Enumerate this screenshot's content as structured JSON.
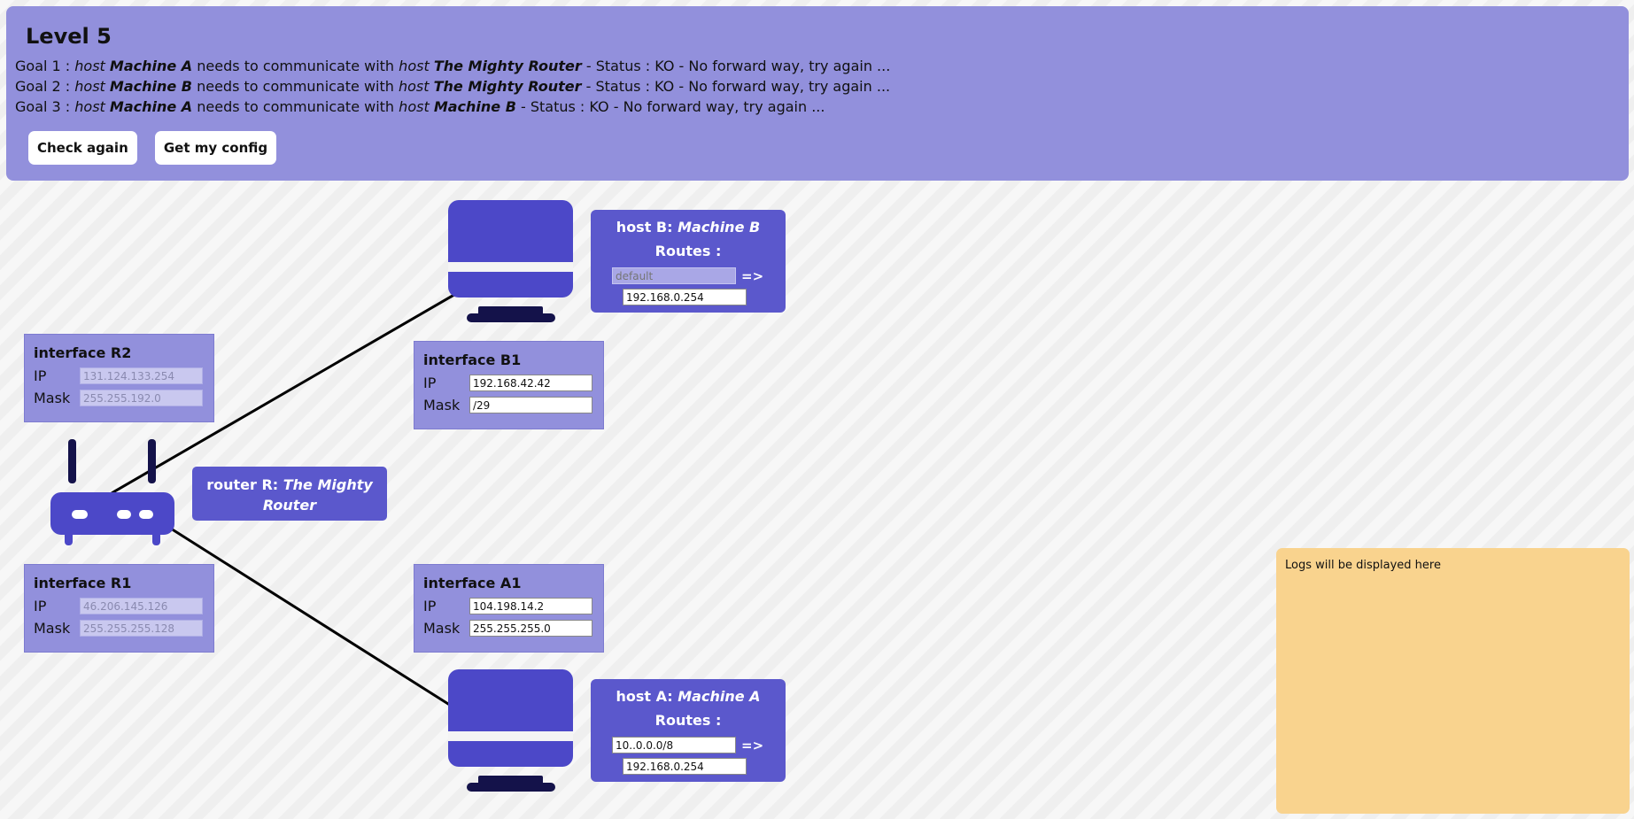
{
  "header": {
    "title": "Level 5",
    "goals": [
      {
        "prefix": "Goal 1 : ",
        "h1_type": "host",
        "h1_name": "Machine A",
        "mid": "needs to communicate with",
        "h2_type": "host",
        "h2_name": "The Mighty Router",
        "status": "- Status : KO - No forward way, try again ..."
      },
      {
        "prefix": "Goal 2 : ",
        "h1_type": "host",
        "h1_name": "Machine B",
        "mid": "needs to communicate with",
        "h2_type": "host",
        "h2_name": "The Mighty Router",
        "status": "- Status : KO - No forward way, try again ..."
      },
      {
        "prefix": "Goal 3 : ",
        "h1_type": "host",
        "h1_name": "Machine A",
        "mid": "needs to communicate with",
        "h2_type": "host",
        "h2_name": "Machine B",
        "status": "- Status : KO - No forward way, try again ..."
      }
    ],
    "buttons": {
      "check": "Check again",
      "config": "Get my config"
    }
  },
  "router": {
    "label": "router R: ",
    "name": "The Mighty Router"
  },
  "interfaces": {
    "r2": {
      "title": "interface R2",
      "ip_label": "IP",
      "mask_label": "Mask",
      "ip": "131.124.133.254",
      "mask": "255.255.192.0"
    },
    "r1": {
      "title": "interface R1",
      "ip_label": "IP",
      "mask_label": "Mask",
      "ip": "46.206.145.126",
      "mask": "255.255.255.128"
    },
    "b1": {
      "title": "interface B1",
      "ip_label": "IP",
      "mask_label": "Mask",
      "ip": "192.168.42.42",
      "mask": "/29"
    },
    "a1": {
      "title": "interface A1",
      "ip_label": "IP",
      "mask_label": "Mask",
      "ip": "104.198.14.2",
      "mask": "255.255.255.0"
    }
  },
  "hosts": {
    "b": {
      "label": "host B: ",
      "name": "Machine B",
      "routes_label": "Routes :",
      "dest": "",
      "dest_placeholder": "default",
      "arrow": "=>",
      "gateway": "192.168.0.254"
    },
    "a": {
      "label": "host A: ",
      "name": "Machine A",
      "routes_label": "Routes :",
      "dest": "10..0.0.0/8",
      "dest_placeholder": "",
      "arrow": "=>",
      "gateway": "192.168.0.254"
    }
  },
  "logs": {
    "text": "Logs will be displayed here"
  },
  "colors": {
    "panel": "#9290dc",
    "box": "#5b58cc",
    "device": "#4c48c8",
    "device_dark": "#14124a",
    "logs": "#f9d38e"
  }
}
